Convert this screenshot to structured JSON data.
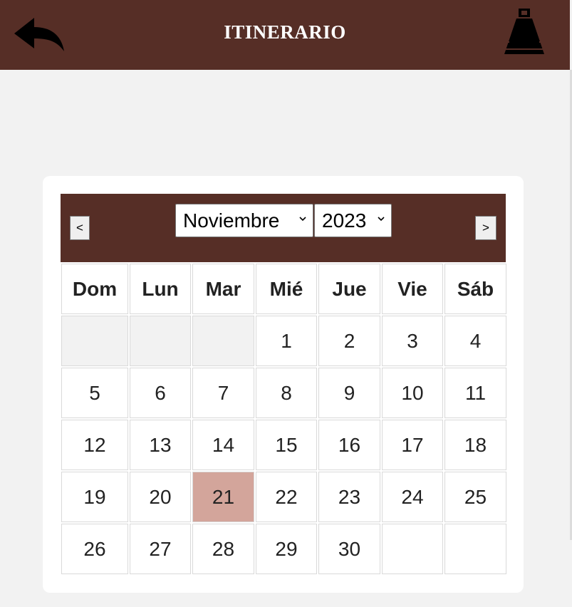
{
  "header": {
    "title": "ITINERARIO",
    "back_icon": "back-arrow-icon",
    "logo_icon": "pyramid-icon",
    "background": "#562e26"
  },
  "calendar": {
    "prev_label": "<",
    "next_label": ">",
    "month_selected": "Noviembre",
    "year_selected": "2023",
    "weekdays": [
      "Dom",
      "Lun",
      "Mar",
      "Mié",
      "Jue",
      "Vie",
      "Sáb"
    ],
    "weeks": [
      [
        "",
        "",
        "",
        "1",
        "2",
        "3",
        "4"
      ],
      [
        "5",
        "6",
        "7",
        "8",
        "9",
        "10",
        "11"
      ],
      [
        "12",
        "13",
        "14",
        "15",
        "16",
        "17",
        "18"
      ],
      [
        "19",
        "20",
        "21",
        "22",
        "23",
        "24",
        "25"
      ],
      [
        "26",
        "27",
        "28",
        "29",
        "30"
      ]
    ],
    "selected_day": "21",
    "selected_color": "#d3a59b"
  }
}
